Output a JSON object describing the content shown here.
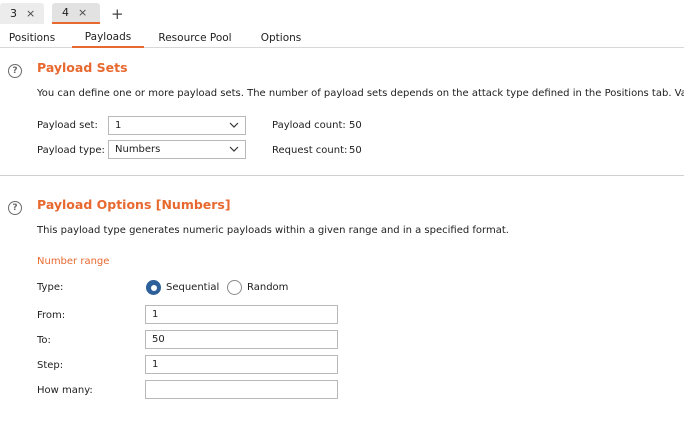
{
  "attack_tabs": [
    {
      "label": "3",
      "close": "×"
    },
    {
      "label": "4",
      "close": "×"
    }
  ],
  "add_tab": "+",
  "sub_tabs": [
    "Positions",
    "Payloads",
    "Resource Pool",
    "Options"
  ],
  "active_sub_tab": "Payloads",
  "payload_sets": {
    "help": "?",
    "title": "Payload Sets",
    "description": "You can define one or more payload sets. The number of payload sets depends on the attack type defined in the Positions tab. Various",
    "set_label": "Payload set:",
    "set_value": "1",
    "type_label": "Payload type:",
    "type_value": "Numbers",
    "count_label": "Payload count:",
    "count_value": "50",
    "request_label": "Request count:",
    "request_value": "50"
  },
  "payload_options": {
    "help": "?",
    "title": "Payload Options [Numbers]",
    "description": "This payload type generates numeric payloads within a given range and in a specified format.",
    "range_heading": "Number range",
    "type_label": "Type:",
    "sequential_label": "Sequential",
    "random_label": "Random",
    "selected_type": "Sequential",
    "from_label": "From:",
    "from_value": "1",
    "to_label": "To:",
    "to_value": "50",
    "step_label": "Step:",
    "step_value": "1",
    "how_many_label": "How many:",
    "how_many_value": ""
  },
  "colors": {
    "accent": "#e8692f",
    "radio_selected": "#2d5f9a"
  }
}
